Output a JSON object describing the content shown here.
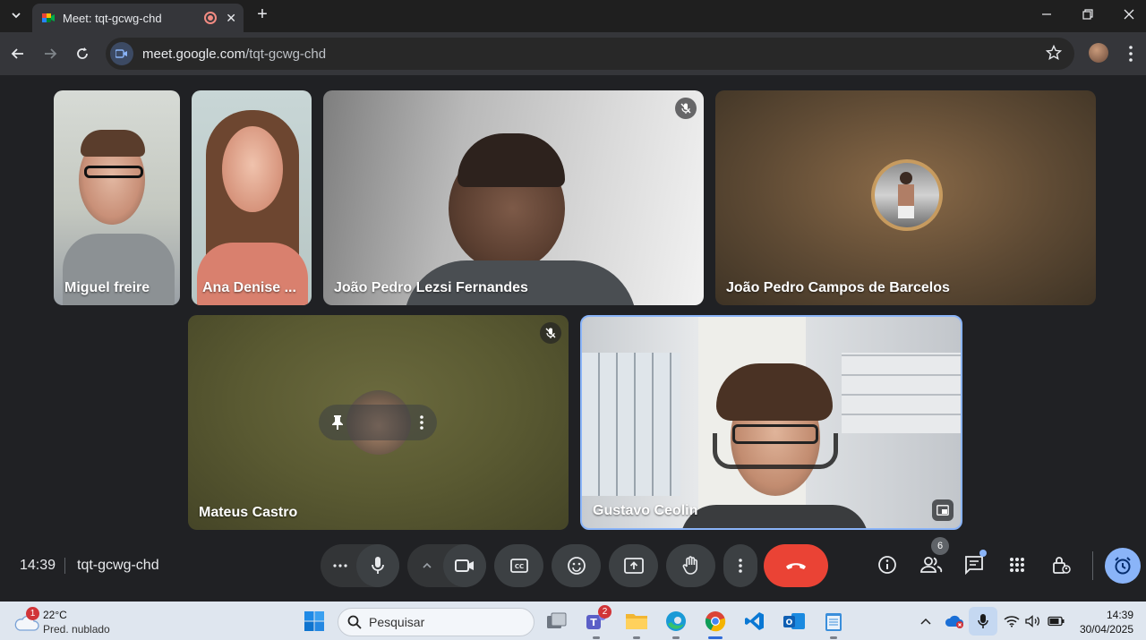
{
  "browser": {
    "tab_title": "Meet: tqt-gcwg-chd",
    "url_host": "meet.google.com",
    "url_path": "/tqt-gcwg-chd",
    "new_tab_symbol": "+",
    "close_symbol": "✕"
  },
  "participants": [
    {
      "name": "Miguel freire"
    },
    {
      "name": "Ana Denise ..."
    },
    {
      "name": "João Pedro Lezsi Fernandes",
      "muted": true
    },
    {
      "name": "João Pedro Campos de Barcelos"
    },
    {
      "name": "Mateus Castro",
      "muted": true
    },
    {
      "name": "Gustavo Ceolin"
    }
  ],
  "meeting": {
    "time": "14:39",
    "code": "tqt-gcwg-chd",
    "people_count": "6"
  },
  "taskbar": {
    "weather_badge": "1",
    "temperature": "22°C",
    "weather_desc": "Pred. nublado",
    "search_placeholder": "Pesquisar",
    "teams_badge": "2",
    "clock_time": "14:39",
    "clock_date": "30/04/2025"
  },
  "colors": {
    "end_call": "#ea4335",
    "meet_bg": "#202124",
    "active_tile_border": "#8ab4f8"
  }
}
